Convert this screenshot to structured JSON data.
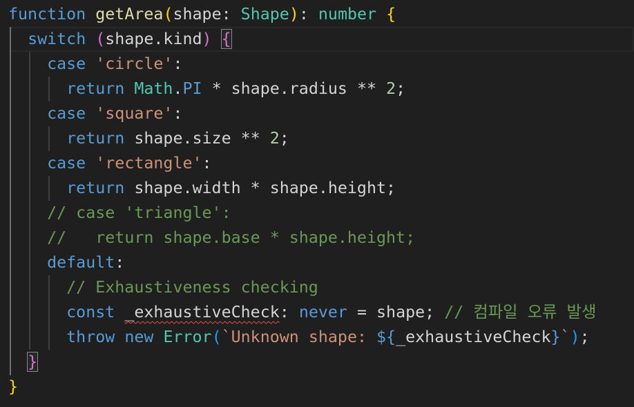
{
  "editor": {
    "language": "typescript",
    "lines": [
      [
        {
          "t": "function",
          "c": "kw"
        },
        {
          "t": " ",
          "c": "var"
        },
        {
          "t": "getArea",
          "c": "fn"
        },
        {
          "t": "(",
          "c": "b1"
        },
        {
          "t": "shape",
          "c": "var"
        },
        {
          "t": ": ",
          "c": "op"
        },
        {
          "t": "Shape",
          "c": "type"
        },
        {
          "t": ")",
          "c": "b1"
        },
        {
          "t": ": ",
          "c": "op"
        },
        {
          "t": "number",
          "c": "type"
        },
        {
          "t": " ",
          "c": "var"
        },
        {
          "t": "{",
          "c": "b1"
        }
      ],
      [
        {
          "t": "  ",
          "c": "var"
        },
        {
          "t": "switch",
          "c": "kw"
        },
        {
          "t": " ",
          "c": "var"
        },
        {
          "t": "(",
          "c": "b2"
        },
        {
          "t": "shape.kind",
          "c": "var"
        },
        {
          "t": ")",
          "c": "b2"
        },
        {
          "t": " ",
          "c": "var"
        },
        {
          "t": "{",
          "c": "b2",
          "m": "bracket-match"
        }
      ],
      [
        {
          "t": "    ",
          "c": "var"
        },
        {
          "t": "case",
          "c": "kw"
        },
        {
          "t": " ",
          "c": "var"
        },
        {
          "t": "'circle'",
          "c": "str"
        },
        {
          "t": ":",
          "c": "op"
        }
      ],
      [
        {
          "t": "      ",
          "c": "var"
        },
        {
          "t": "return",
          "c": "kw"
        },
        {
          "t": " ",
          "c": "var"
        },
        {
          "t": "Math",
          "c": "type"
        },
        {
          "t": ".",
          "c": "op"
        },
        {
          "t": "PI",
          "c": "kw"
        },
        {
          "t": " * shape.radius ** ",
          "c": "var"
        },
        {
          "t": "2",
          "c": "num"
        },
        {
          "t": ";",
          "c": "op"
        }
      ],
      [
        {
          "t": "    ",
          "c": "var"
        },
        {
          "t": "case",
          "c": "kw"
        },
        {
          "t": " ",
          "c": "var"
        },
        {
          "t": "'square'",
          "c": "str"
        },
        {
          "t": ":",
          "c": "op"
        }
      ],
      [
        {
          "t": "      ",
          "c": "var"
        },
        {
          "t": "return",
          "c": "kw"
        },
        {
          "t": " shape.size ** ",
          "c": "var"
        },
        {
          "t": "2",
          "c": "num"
        },
        {
          "t": ";",
          "c": "op"
        }
      ],
      [
        {
          "t": "    ",
          "c": "var"
        },
        {
          "t": "case",
          "c": "kw"
        },
        {
          "t": " ",
          "c": "var"
        },
        {
          "t": "'rectangle'",
          "c": "str"
        },
        {
          "t": ":",
          "c": "op"
        }
      ],
      [
        {
          "t": "      ",
          "c": "var"
        },
        {
          "t": "return",
          "c": "kw"
        },
        {
          "t": " shape.width * shape.height;",
          "c": "var"
        }
      ],
      [
        {
          "t": "    ",
          "c": "var"
        },
        {
          "t": "// case 'triangle':",
          "c": "com"
        }
      ],
      [
        {
          "t": "    ",
          "c": "var"
        },
        {
          "t": "//   return shape.base * shape.height;",
          "c": "com"
        }
      ],
      [
        {
          "t": "    ",
          "c": "var"
        },
        {
          "t": "default",
          "c": "kw"
        },
        {
          "t": ":",
          "c": "op"
        }
      ],
      [
        {
          "t": "      ",
          "c": "var"
        },
        {
          "t": "// Exhaustiveness checking",
          "c": "com"
        }
      ],
      [
        {
          "t": "      ",
          "c": "var"
        },
        {
          "t": "const",
          "c": "kw"
        },
        {
          "t": " ",
          "c": "var"
        },
        {
          "t": "_exhaustiveCheck",
          "c": "var",
          "m": "squiggle"
        },
        {
          "t": ": ",
          "c": "op"
        },
        {
          "t": "never",
          "c": "kw"
        },
        {
          "t": " = shape; ",
          "c": "var"
        },
        {
          "t": "// 컴파일 오류 발생",
          "c": "com"
        }
      ],
      [
        {
          "t": "      ",
          "c": "var"
        },
        {
          "t": "throw",
          "c": "kw"
        },
        {
          "t": " ",
          "c": "var"
        },
        {
          "t": "new",
          "c": "kw"
        },
        {
          "t": " ",
          "c": "var"
        },
        {
          "t": "Error",
          "c": "type"
        },
        {
          "t": "(",
          "c": "b3"
        },
        {
          "t": "`Unknown shape: ",
          "c": "str"
        },
        {
          "t": "${",
          "c": "kw"
        },
        {
          "t": "_exhaustiveCheck",
          "c": "var"
        },
        {
          "t": "}",
          "c": "kw"
        },
        {
          "t": "`",
          "c": "str"
        },
        {
          "t": ")",
          "c": "b3"
        },
        {
          "t": ";",
          "c": "op"
        }
      ],
      [
        {
          "t": "  ",
          "c": "var"
        },
        {
          "t": "}",
          "c": "b2",
          "m": "bracket-match"
        }
      ],
      [
        {
          "t": "}",
          "c": "b1"
        }
      ]
    ]
  }
}
